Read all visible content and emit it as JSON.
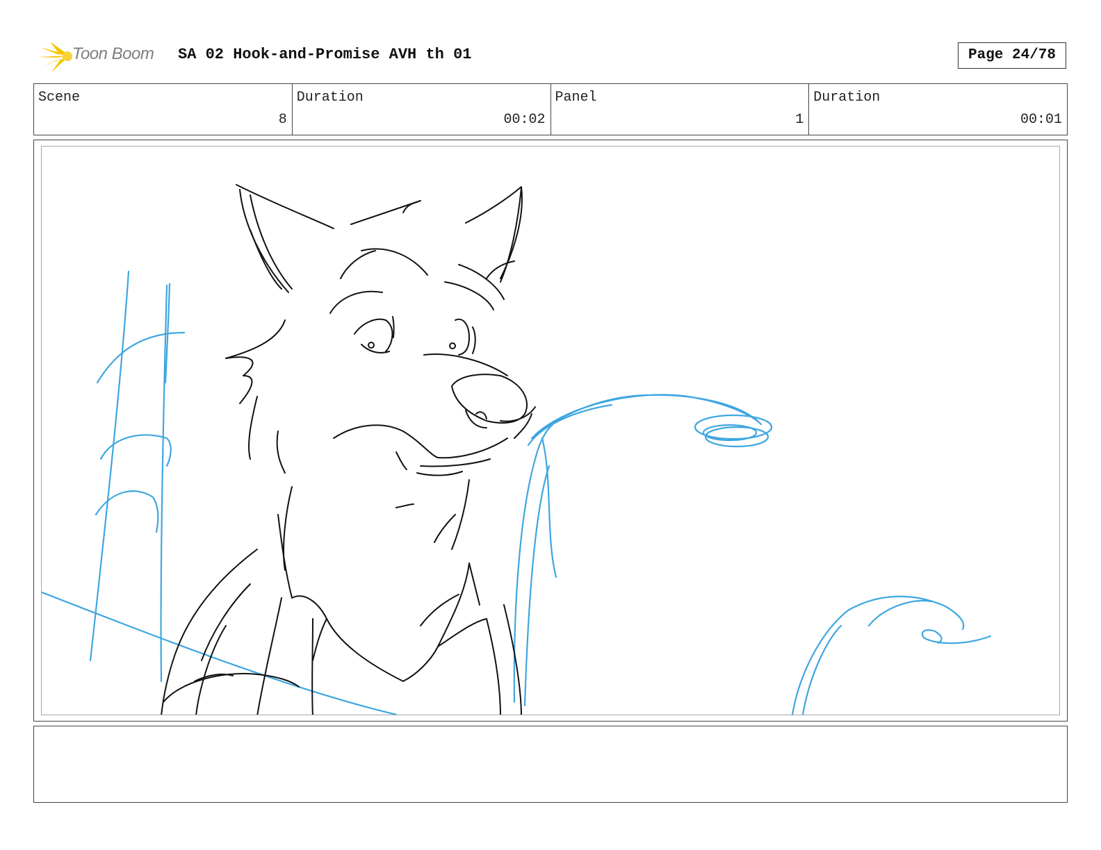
{
  "header": {
    "logo_text": "Toon Boom",
    "title": "SA 02 Hook-and-Promise AVH th 01",
    "page_label": "Page 24/78"
  },
  "info": {
    "scene_label": "Scene",
    "scene_value": "8",
    "scene_duration_label": "Duration",
    "scene_duration_value": "00:02",
    "panel_label": "Panel",
    "panel_value": "1",
    "panel_duration_label": "Duration",
    "panel_duration_value": "00:01"
  },
  "notes": {
    "text": ""
  },
  "colors": {
    "sketch_black": "#111111",
    "sketch_blue": "#3ea6e0",
    "logo_yellow": "#f5c400",
    "logo_gray": "#7d7d7d"
  }
}
